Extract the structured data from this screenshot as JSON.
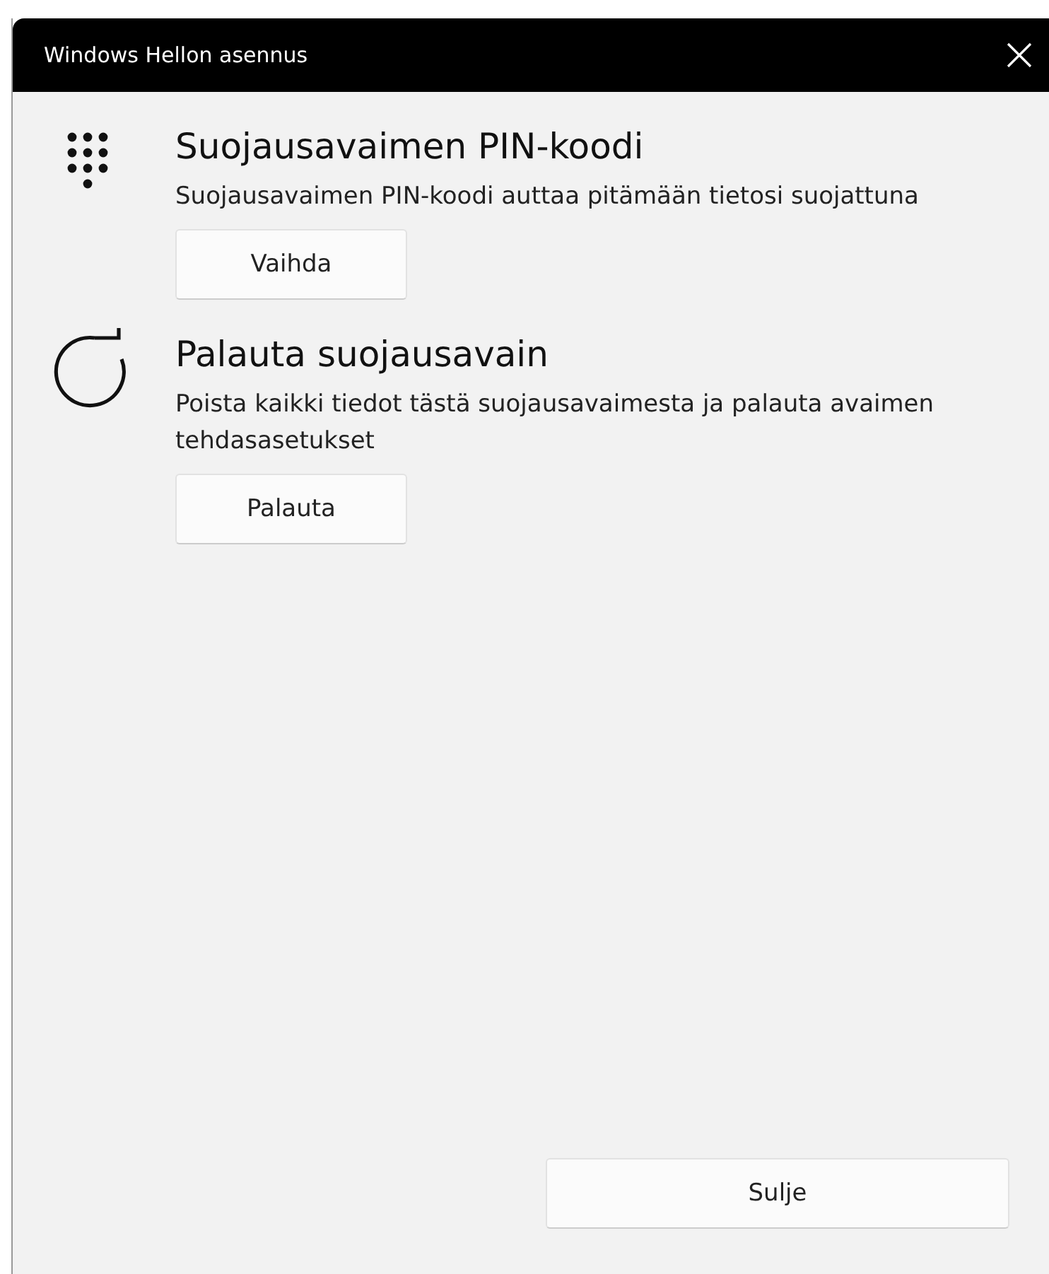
{
  "window": {
    "title": "Windows Hellon asennus"
  },
  "sections": [
    {
      "kind": "pin",
      "heading": "Suojausavaimen PIN-koodi",
      "description": "Suojausavaimen PIN-koodi auttaa pitämään tietosi suojattuna",
      "button": "Vaihda"
    },
    {
      "kind": "reset",
      "heading": "Palauta suojausavain",
      "description": "Poista kaikki tiedot tästä suojausavaimesta ja palauta avaimen tehdasasetukset",
      "button": "Palauta"
    }
  ],
  "close_button": "Sulje"
}
